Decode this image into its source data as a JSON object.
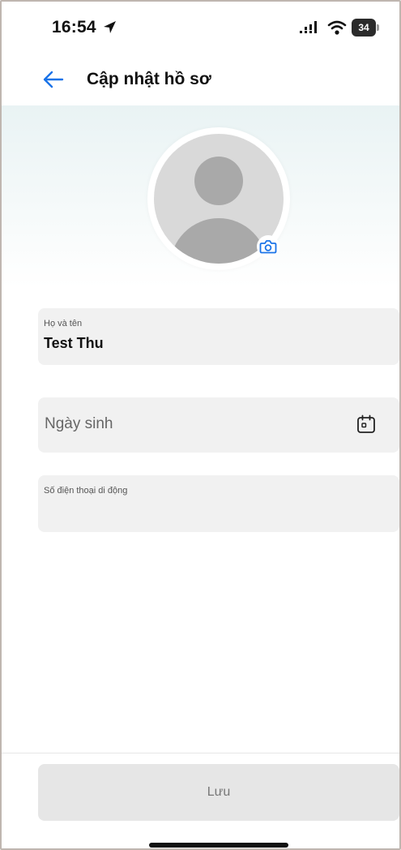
{
  "status_bar": {
    "time": "16:54",
    "battery": "34",
    "icons": [
      "location-arrow-icon",
      "signal-icon",
      "wifi-icon",
      "battery-icon"
    ]
  },
  "nav": {
    "back_icon": "arrow-left-icon",
    "title": "Cập nhật hồ sơ",
    "accent_color": "#1a73e8"
  },
  "profile": {
    "avatar_icon": "default-avatar-icon",
    "camera_icon": "camera-icon"
  },
  "form": {
    "fullname": {
      "label": "Họ và tên",
      "value": "Test Thu"
    },
    "dob": {
      "placeholder": "Ngày sinh",
      "icon": "calendar-icon"
    },
    "phone": {
      "label": "Số điện thoại di động",
      "value": ""
    }
  },
  "footer": {
    "save_label": "Lưu"
  }
}
